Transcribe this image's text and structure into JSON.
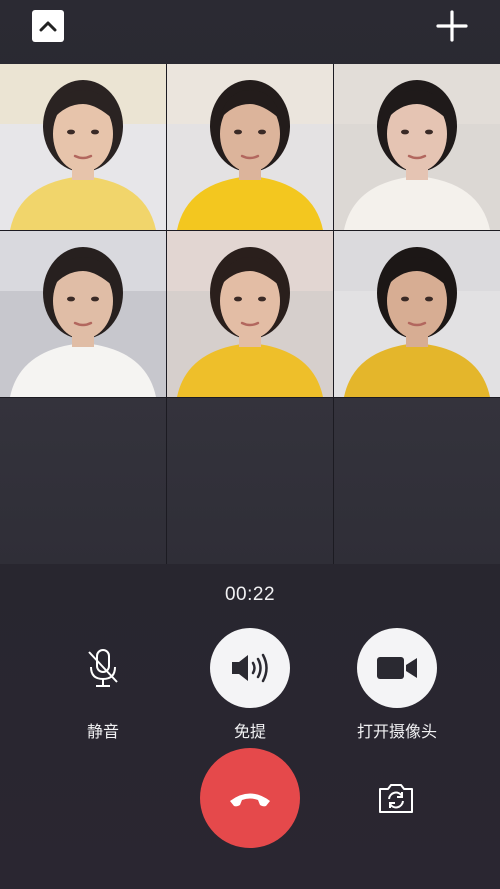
{
  "call": {
    "timer": "00:22",
    "participants": [
      {
        "name": "participant-1",
        "bg": "#e7e6e9",
        "top": "#efe2c4",
        "skin": "#e7c4ab",
        "hair": "#2a2322",
        "shirt": "#f1d56b"
      },
      {
        "name": "participant-2",
        "bg": "#e4e2e3",
        "top": "#f0e8d8",
        "skin": "#dcb49b",
        "hair": "#231c1b",
        "shirt": "#f3c71f"
      },
      {
        "name": "participant-3",
        "bg": "#dcd8d4",
        "top": "#e6e1db",
        "skin": "#e5c4b3",
        "hair": "#1f1a1a",
        "shirt": "#f4f1ec"
      },
      {
        "name": "participant-4",
        "bg": "#c7c7cd",
        "top": "#e5e5ea",
        "skin": "#e0bda6",
        "hair": "#27201f",
        "shirt": "#f5f4f2"
      },
      {
        "name": "participant-5",
        "bg": "#d6cfcc",
        "top": "#eadad5",
        "skin": "#e3bda5",
        "hair": "#2a1f1c",
        "shirt": "#eebf2a"
      },
      {
        "name": "participant-6",
        "bg": "#e2e1e3",
        "top": "#d7d5d8",
        "skin": "#d7ad93",
        "hair": "#1c1716",
        "shirt": "#e4b62b"
      }
    ]
  },
  "controls": {
    "mute_label": "静音",
    "speaker_label": "免提",
    "camera_label": "打开摄像头"
  },
  "icons": {
    "collapse": "chevron-up-icon",
    "add": "plus-icon",
    "mute": "microphone-off-icon",
    "speaker": "speaker-icon",
    "camera": "video-camera-icon",
    "hangup": "phone-hangup-icon",
    "flip": "camera-flip-icon"
  },
  "colors": {
    "hangup": "#e5494b",
    "control_circle": "#f4f4f6",
    "background": "#2b2a33"
  }
}
